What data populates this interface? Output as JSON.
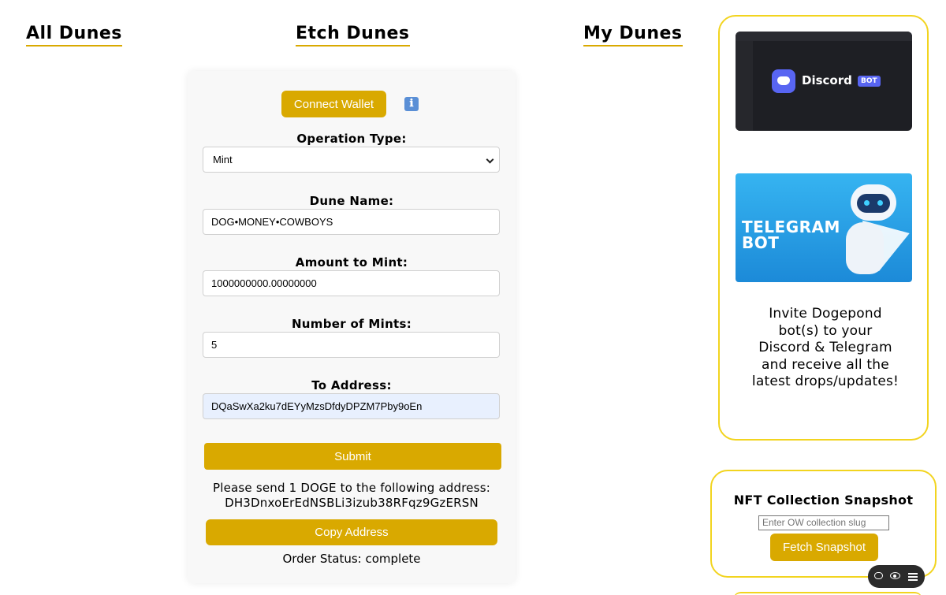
{
  "nav": {
    "all_dunes": "All Dunes",
    "etch_dunes": "Etch Dunes",
    "my_dunes": "My Dunes"
  },
  "form": {
    "connect_wallet": "Connect Wallet",
    "info_icon": "ℹ",
    "operation_type_label": "Operation Type:",
    "operation_type_value": "Mint",
    "dune_name_label": "Dune Name:",
    "dune_name_value": "DOG•MONEY•COWBOYS",
    "amount_label": "Amount to Mint:",
    "amount_value": "1000000000.00000000",
    "mints_label": "Number of Mints:",
    "mints_value": "5",
    "address_label": "To Address:",
    "address_value": "DQaSwXa2ku7dEYyMzsDfdyDPZM7Pby9oEn",
    "submit": "Submit",
    "send_line1": "Please send 1 DOGE to the following address:",
    "send_address": "DH3DnxoErEdNSBLi3izub38RFqz9GzERSN",
    "copy_address": "Copy Address",
    "order_status": "Order Status: complete"
  },
  "promo": {
    "discord_word": "Discord",
    "discord_badge": "BOT",
    "telegram_word": "TELEGRAM\nBOT",
    "text": "Invite Dogepond bot(s) to your Discord & Telegram and receive all the latest drops/updates!"
  },
  "snapshot": {
    "title": "NFT Collection Snapshot",
    "input_placeholder": "Enter OW collection slug",
    "fetch_button": "Fetch Snapshot"
  },
  "colors": {
    "accent": "#d9a900",
    "card_border": "#f2d41f"
  }
}
